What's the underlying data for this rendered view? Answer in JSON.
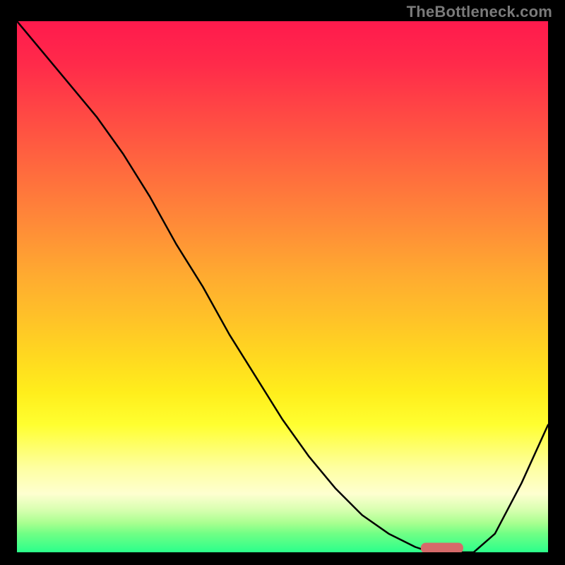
{
  "watermark": {
    "text": "TheBottleneck.com"
  },
  "colors": {
    "frame": "#000000",
    "curve": "#000000",
    "marker": "#d66a6a",
    "gradient_top": "#ff1a4d",
    "gradient_bottom": "#2bff8b"
  },
  "chart_data": {
    "type": "line",
    "title": "",
    "xlabel": "",
    "ylabel": "",
    "xlim": [
      0,
      100
    ],
    "ylim": [
      0,
      100
    ],
    "x": [
      0,
      5,
      10,
      15,
      20,
      25,
      30,
      35,
      40,
      45,
      50,
      55,
      60,
      65,
      70,
      75,
      78,
      82,
      86,
      90,
      95,
      100
    ],
    "values": [
      100,
      94,
      88,
      82,
      75,
      67,
      58,
      50,
      41,
      33,
      25,
      18,
      12,
      7,
      3.5,
      1,
      0,
      0,
      0,
      3.5,
      13,
      24
    ],
    "annotations": [
      {
        "type": "marker",
        "x_range": [
          76,
          84
        ],
        "y": 0
      }
    ],
    "notes": "V-shaped bottleneck curve over vertical red-to-green gradient. Values are percent (0=bottom/green, 100=top/red), estimated from pixels."
  }
}
